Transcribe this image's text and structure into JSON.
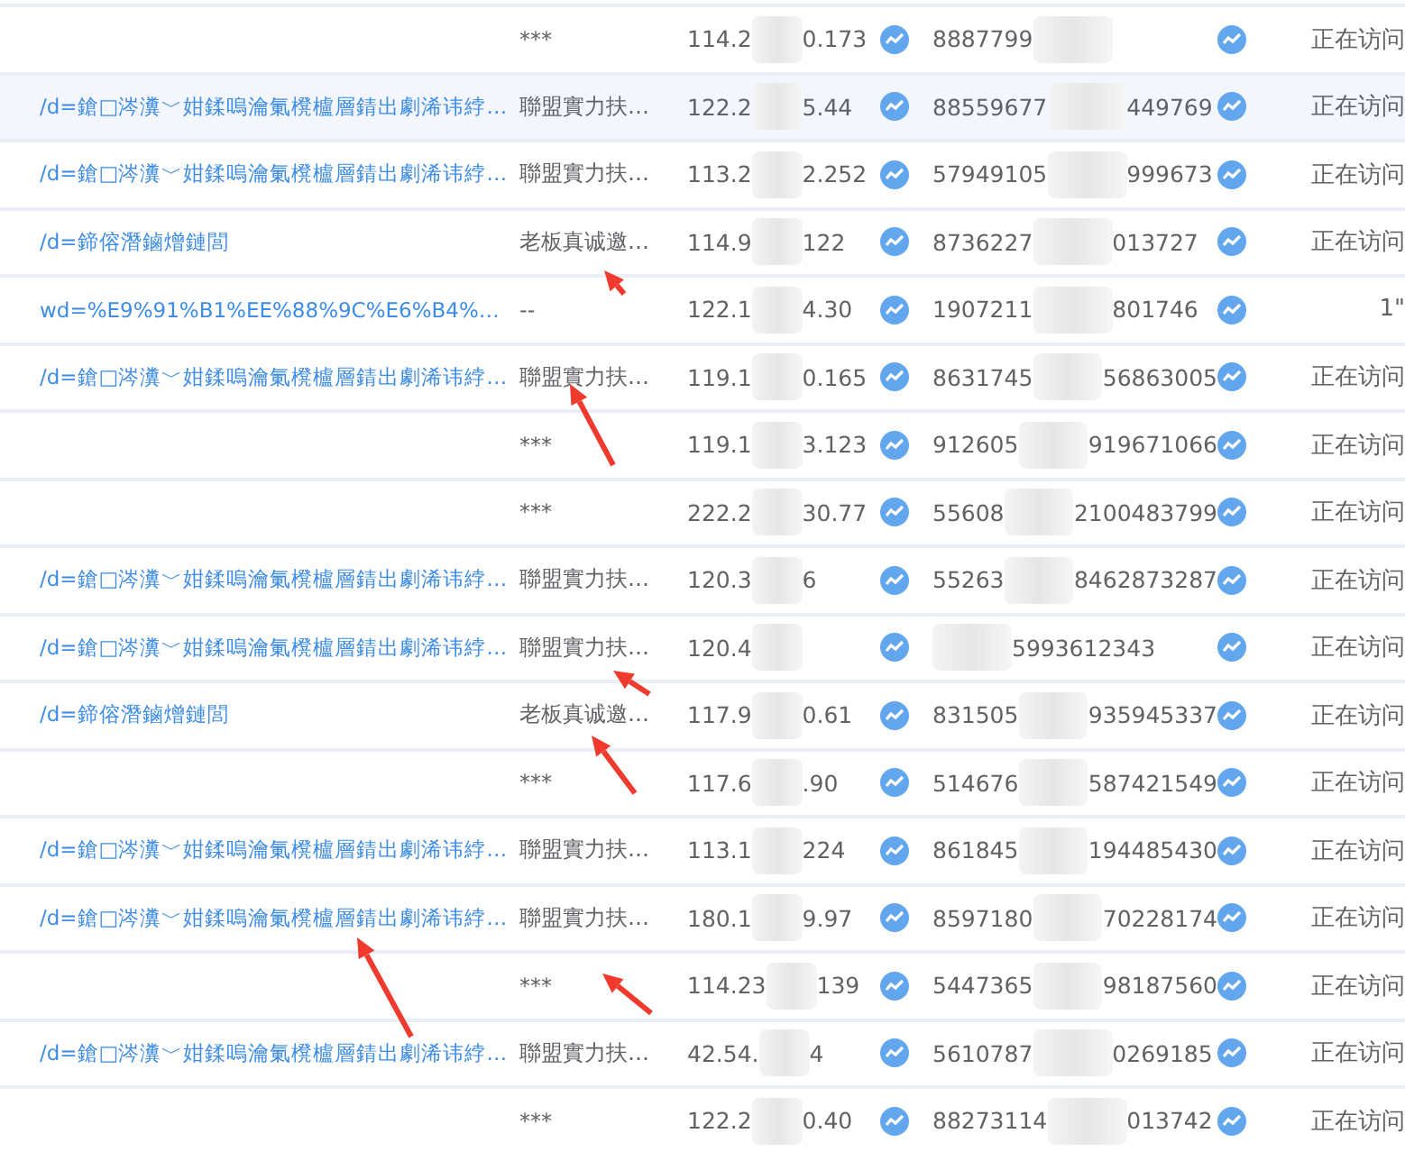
{
  "rows": [
    {
      "url": null,
      "source": "***",
      "ip": {
        "start": "114.2",
        "end": "0.173"
      },
      "id": {
        "start": "8887799"
      },
      "status": "正在访问",
      "selected": false
    },
    {
      "url": "/d=鎗□涔瀵﹀姏鍒嗚瀹氭櫈櫨層錆出劇浠讳綍…",
      "source": "聯盟實力扶…",
      "ip": {
        "start": "122.2",
        "end": "5.44"
      },
      "id": {
        "start": "88559677",
        "end": "449769"
      },
      "status": "正在访问",
      "selected": true
    },
    {
      "url": "/d=鎗□涔瀵﹀姏鍒嗚瀹氭櫈櫨層錆出劇浠讳綍…",
      "source": "聯盟實力扶…",
      "ip": {
        "start": "113.2",
        "end": "2.252"
      },
      "id": {
        "start": "57949105",
        "end": "999673"
      },
      "status": "正在访问",
      "selected": false
    },
    {
      "url": "/d=鍗傛潛鏀熷鏈閭",
      "source": "老板真诚邀…",
      "ip": {
        "start": "114.9",
        "end": "122"
      },
      "id": {
        "start": "8736227",
        "end": "013727"
      },
      "status": "正在访问",
      "selected": false
    },
    {
      "url": "wd=%E9%91%B1%EE%88%9C%E6%B4%…",
      "source": "--",
      "ip": {
        "start": "122.1",
        "end": "4.30"
      },
      "id": {
        "start": "1907211",
        "end": "801746"
      },
      "status": "1\"",
      "selected": false
    },
    {
      "url": "/d=鎗□涔瀵﹀姏鍒嗚瀹氭櫈櫨層錆出劇浠讳綍…",
      "source": "聯盟實力扶…",
      "ip": {
        "start": "119.1",
        "end": "0.165"
      },
      "id": {
        "start": "8631745",
        "end": "56863005"
      },
      "status": "正在访问",
      "selected": false
    },
    {
      "url": null,
      "source": "***",
      "ip": {
        "start": "119.1",
        "end": "3.123"
      },
      "id": {
        "start": "912605",
        "end": "919671066"
      },
      "status": "正在访问",
      "selected": false
    },
    {
      "url": null,
      "source": "***",
      "ip": {
        "start": "222.2",
        "end": "30.77"
      },
      "id": {
        "start": "55608",
        "end": "2100483799"
      },
      "status": "正在访问",
      "selected": false
    },
    {
      "url": "/d=鎗□涔瀵﹀姏鍒嗚瀹氭櫈櫨層錆出劇浠讳綍…",
      "source": "聯盟實力扶…",
      "ip": {
        "start": "120.3",
        "end": "6"
      },
      "id": {
        "start": "55263",
        "end": "8462873287"
      },
      "status": "正在访问",
      "selected": false
    },
    {
      "url": "/d=鎗□涔瀵﹀姏鍒嗚瀹氭櫈櫨層錆出劇浠讳綍…",
      "source": "聯盟實力扶…",
      "ip": {
        "start": "120.4"
      },
      "id": {
        "end": "5993612343"
      },
      "status": "正在访问",
      "selected": false
    },
    {
      "url": "/d=鍗傛潛鏀熷鏈閭",
      "source": "老板真诚邀…",
      "ip": {
        "start": "117.9",
        "end": "0.61"
      },
      "id": {
        "start": "831505",
        "end": "935945337"
      },
      "status": "正在访问",
      "selected": false
    },
    {
      "url": null,
      "source": "***",
      "ip": {
        "start": "117.6",
        "end": ".90"
      },
      "id": {
        "start": "514676",
        "end": "587421549"
      },
      "status": "正在访问",
      "selected": false
    },
    {
      "url": "/d=鎗□涔瀵﹀姏鍒嗚瀹氭櫈櫨層錆出劇浠讳綍…",
      "source": "聯盟實力扶…",
      "ip": {
        "start": "113.1",
        "end": "224"
      },
      "id": {
        "start": "861845",
        "end": "194485430"
      },
      "status": "正在访问",
      "selected": false
    },
    {
      "url": "/d=鎗□涔瀵﹀姏鍒嗚瀹氭櫈櫨層錆出劇浠讳綍…",
      "source": "聯盟實力扶…",
      "ip": {
        "start": "180.1",
        "end": "9.97"
      },
      "id": {
        "start": "8597180",
        "end": "70228174"
      },
      "status": "正在访问",
      "selected": false
    },
    {
      "url": null,
      "source": "***",
      "ip": {
        "start": "114.23",
        "end": "139"
      },
      "id": {
        "start": "5447365",
        "end": "98187560"
      },
      "status": "正在访问",
      "selected": false
    },
    {
      "url": "/d=鎗□涔瀵﹀姏鍒嗚瀹氭櫈櫨層錆出劇浠讳綍…",
      "source": "聯盟實力扶…",
      "ip": {
        "start": "42.54.",
        "end": "4"
      },
      "id": {
        "start": "5610787",
        "end": "0269185"
      },
      "status": "正在访问",
      "selected": false
    },
    {
      "url": null,
      "source": "***",
      "ip": {
        "start": "122.2",
        "end": "0.40"
      },
      "id": {
        "start": "88273114",
        "end": "013742"
      },
      "status": "正在访问",
      "selected": false
    }
  ]
}
